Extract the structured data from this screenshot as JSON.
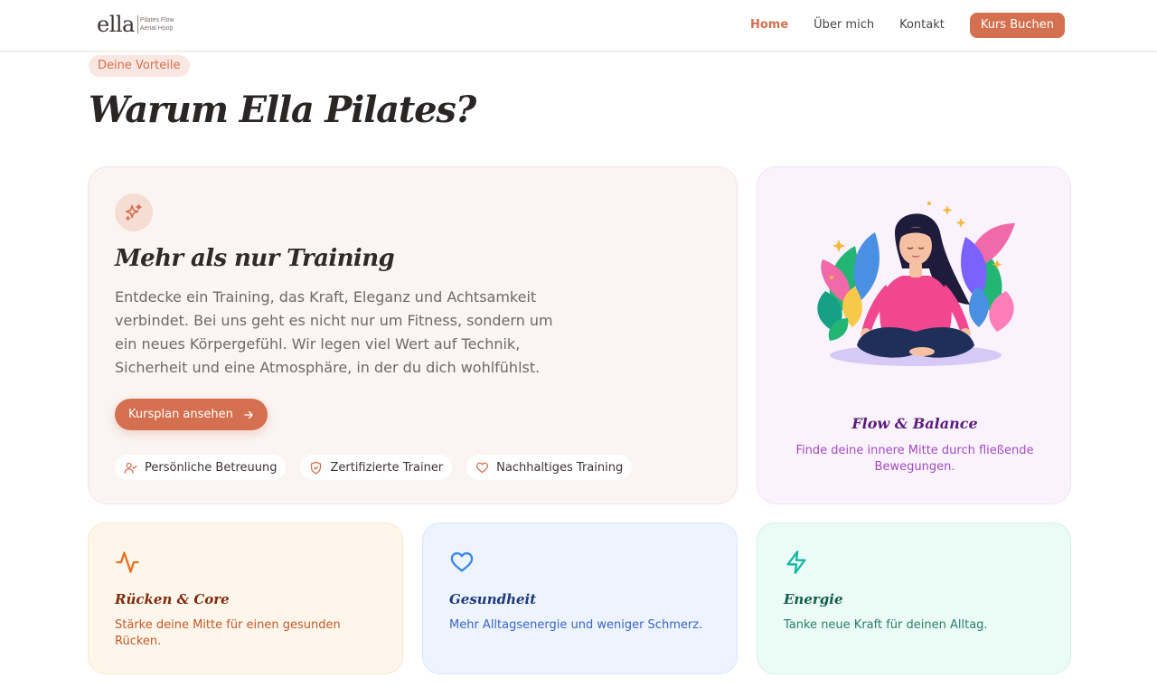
{
  "header": {
    "logo": {
      "word": "ella",
      "line1": "Pilates Flow",
      "line2": "Aerial Hoop"
    },
    "nav": [
      {
        "label": "Home",
        "active": true
      },
      {
        "label": "Über mich",
        "active": false
      },
      {
        "label": "Kontakt",
        "active": false
      }
    ],
    "cta_label": "Kurs Buchen"
  },
  "section": {
    "tag": "Deine Vorteile",
    "title": "Warum Ella Pilates?"
  },
  "main_card": {
    "icon": "sparkles-icon",
    "title": "Mehr als nur Training",
    "text": "Entdecke ein Training, das Kraft, Eleganz und Achtsamkeit verbindet. Bei uns geht es nicht nur um Fitness, sondern um ein neues Körpergefühl. Wir legen viel Wert auf Technik, Sicherheit und eine Atmosphäre, in der du dich wohlfühlst.",
    "button_label": "Kursplan ansehen",
    "features": [
      {
        "icon": "user-check-icon",
        "label": "Persönliche Betreuung"
      },
      {
        "icon": "shield-check-icon",
        "label": "Zertifizierte Trainer"
      },
      {
        "icon": "heart-icon",
        "label": "Nachhaltiges Training"
      }
    ]
  },
  "flow_card": {
    "title": "Flow & Balance",
    "text": "Finde deine innere Mitte durch fließende Bewegungen."
  },
  "benefit_cards": [
    {
      "icon": "activity-icon",
      "title": "Rücken & Core",
      "text": "Stärke deine Mitte für einen gesunden Rücken."
    },
    {
      "icon": "heart-icon",
      "title": "Gesundheit",
      "text": "Mehr Alltagsenergie und weniger Schmerz."
    },
    {
      "icon": "zap-icon",
      "title": "Energie",
      "text": "Tanke neue Kraft für deinen Alltag."
    }
  ],
  "colors": {
    "accent": "#d4704f",
    "flow_title": "#5a1d7a",
    "flow_text": "#a34bc0"
  }
}
